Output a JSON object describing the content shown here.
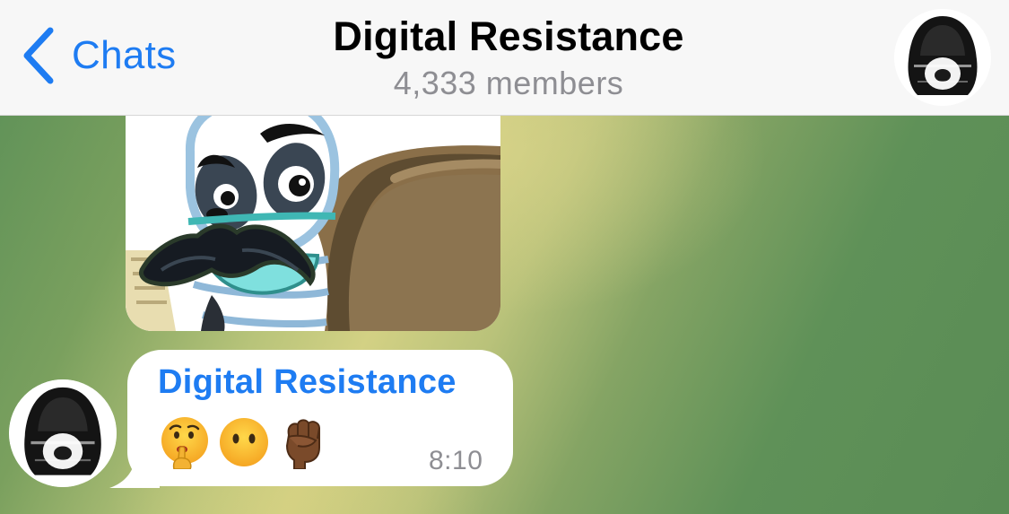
{
  "navbar": {
    "back_label": "Chats",
    "title": "Digital Resistance",
    "subtitle": "4,333 members"
  },
  "messages": [
    {
      "type": "sticker",
      "sticker_icon": "mustache-panda-sticker"
    },
    {
      "type": "text",
      "sender": "Digital Resistance",
      "emojis": [
        "shushing-face-icon",
        "face-without-mouth-icon",
        "raised-fist-dark-skin-icon"
      ],
      "time": "8:10"
    }
  ],
  "colors": {
    "accent": "#1e7cf2",
    "navbar_bg": "#f7f7f7",
    "subtitle": "#8e8e93",
    "bubble": "#ffffff"
  }
}
